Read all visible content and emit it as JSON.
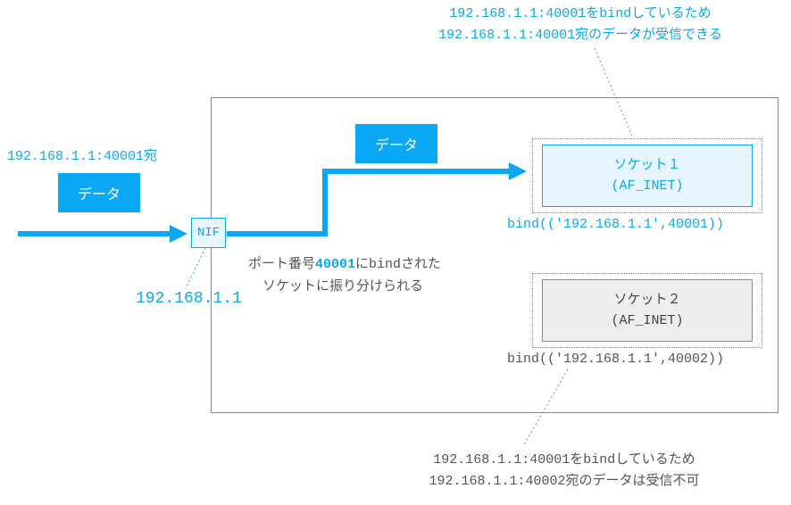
{
  "annotation_top": {
    "line1": "192.168.1.1:40001をbindしているため",
    "line2": "192.168.1.1:40001宛のデータが受信できる"
  },
  "incoming": {
    "dest_label": "192.168.1.1:40001宛",
    "data_tag": "データ"
  },
  "nif": {
    "label": "NIF",
    "ip": "192.168.1.1"
  },
  "routing_note": {
    "prefix": "ポート番号",
    "port": "40001",
    "suffix": "にbindされた",
    "line2": "ソケットに振り分けられる"
  },
  "inner_data_tag": "データ",
  "socket1": {
    "title": "ソケット１",
    "family": "(AF_INET)",
    "bind": "bind(('192.168.1.1',40001))"
  },
  "socket2": {
    "title": "ソケット２",
    "family": "(AF_INET)",
    "bind": "bind(('192.168.1.1',40002))"
  },
  "annotation_bottom": {
    "line1": "192.168.1.1:40001をbindしているため",
    "line2": "192.168.1.1:40002宛のデータは受信不可"
  }
}
